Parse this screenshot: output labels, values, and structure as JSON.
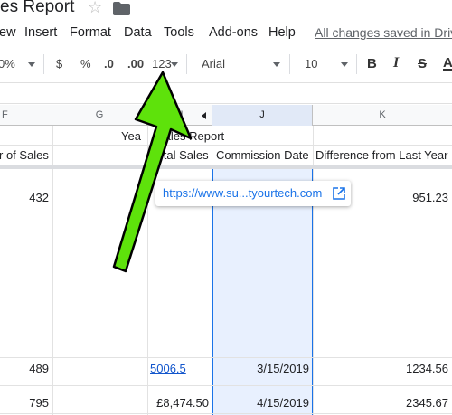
{
  "title_bar": {
    "doc_title": "es Report"
  },
  "menu": {
    "items": [
      "ew",
      "Insert",
      "Format",
      "Data",
      "Tools",
      "Add-ons",
      "Help"
    ],
    "saved_status": "All changes saved in Drive"
  },
  "toolbar": {
    "zoom": "0%",
    "currency": "$",
    "percent": "%",
    "decrease_decimal": ".0",
    "increase_decimal": ".00",
    "more_formats": "123",
    "font": "Arial",
    "font_size": "10",
    "bold": "B",
    "italic": "I",
    "strike": "S",
    "text_color": "A"
  },
  "columns": [
    "F",
    "G",
    "H",
    "J",
    "K"
  ],
  "sheet": {
    "title_fragment_1": "Yea",
    "title_fragment_2": "Sales Report",
    "headers": {
      "f": "r of Sales",
      "h": "Total Sales",
      "j": "Commission Date",
      "k": "Difference from Last Year"
    },
    "rows": [
      {
        "f": "432",
        "h": "",
        "j": "",
        "k": "951.23"
      },
      {
        "f": "489",
        "h": "5006.5",
        "j": "3/15/2019",
        "k": "1234.56"
      },
      {
        "f": "795",
        "h": "£8,474.50",
        "j": "4/15/2019",
        "k": "2345.67"
      }
    ]
  },
  "link_popup": {
    "url": "https://www.su...tyourtech.com"
  },
  "colors": {
    "arrow_fill": "#5ee20b",
    "selection": "#e8f0fe",
    "selection_border": "#1a73e8",
    "link": "#1155cc"
  }
}
